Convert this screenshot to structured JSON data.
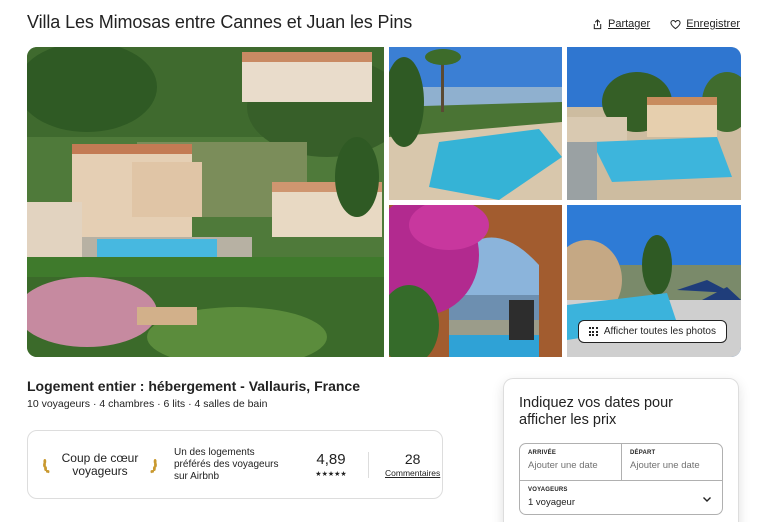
{
  "header": {
    "title": "Villa Les Mimosas entre Cannes et Juan les Pins",
    "share_label": "Partager",
    "save_label": "Enregistrer"
  },
  "gallery": {
    "show_all_label": "Afficher toutes les photos"
  },
  "listing": {
    "location_title": "Logement entier : hébergement - Vallauris, France",
    "details": "10 voyageurs · 4 chambres · 6 lits · 4 salles de bain"
  },
  "guest_favorite": {
    "badge": "Coup de cœur voyageurs",
    "description": "Un des logements préférés des voyageurs sur Airbnb",
    "rating": "4,89",
    "stars": "★★★★★",
    "reviews_count": "28",
    "reviews_label": "Commentaires"
  },
  "booking": {
    "title": "Indiquez vos dates pour afficher les prix",
    "arrival_label": "ARRIVÉE",
    "arrival_placeholder": "Ajouter une date",
    "departure_label": "DÉPART",
    "departure_placeholder": "Ajouter une date",
    "guests_label": "VOYAGEURS",
    "guests_value": "1 voyageur"
  },
  "icons": {
    "share": "share-icon",
    "save": "heart-icon",
    "grid": "grid-icon",
    "chevron": "chevron-down-icon",
    "laurel": "laurel-icon"
  }
}
